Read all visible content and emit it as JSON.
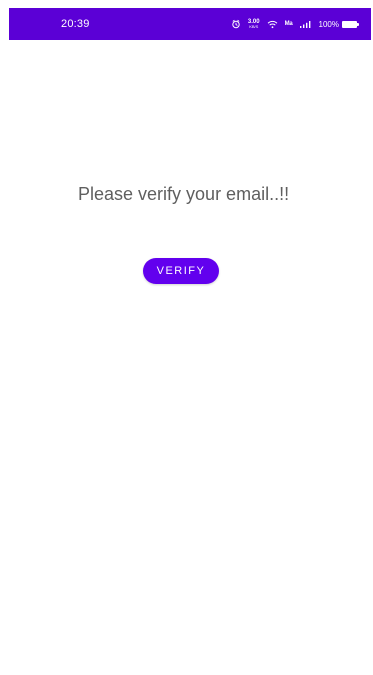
{
  "status_bar": {
    "time": "20:39",
    "network_speed_value": "3.00",
    "network_speed_unit": "KB/S",
    "network_type": "Ma",
    "battery_text": "100%",
    "background": "#5b00d6",
    "icons": {
      "alarm": "alarm-icon",
      "wifi": "wifi-icon",
      "signal": "signal-icon",
      "battery": "battery-icon"
    }
  },
  "content": {
    "message": "Please verify your email..!!",
    "verify_button_label": "VERIFY",
    "accent_color": "#6200ee"
  }
}
